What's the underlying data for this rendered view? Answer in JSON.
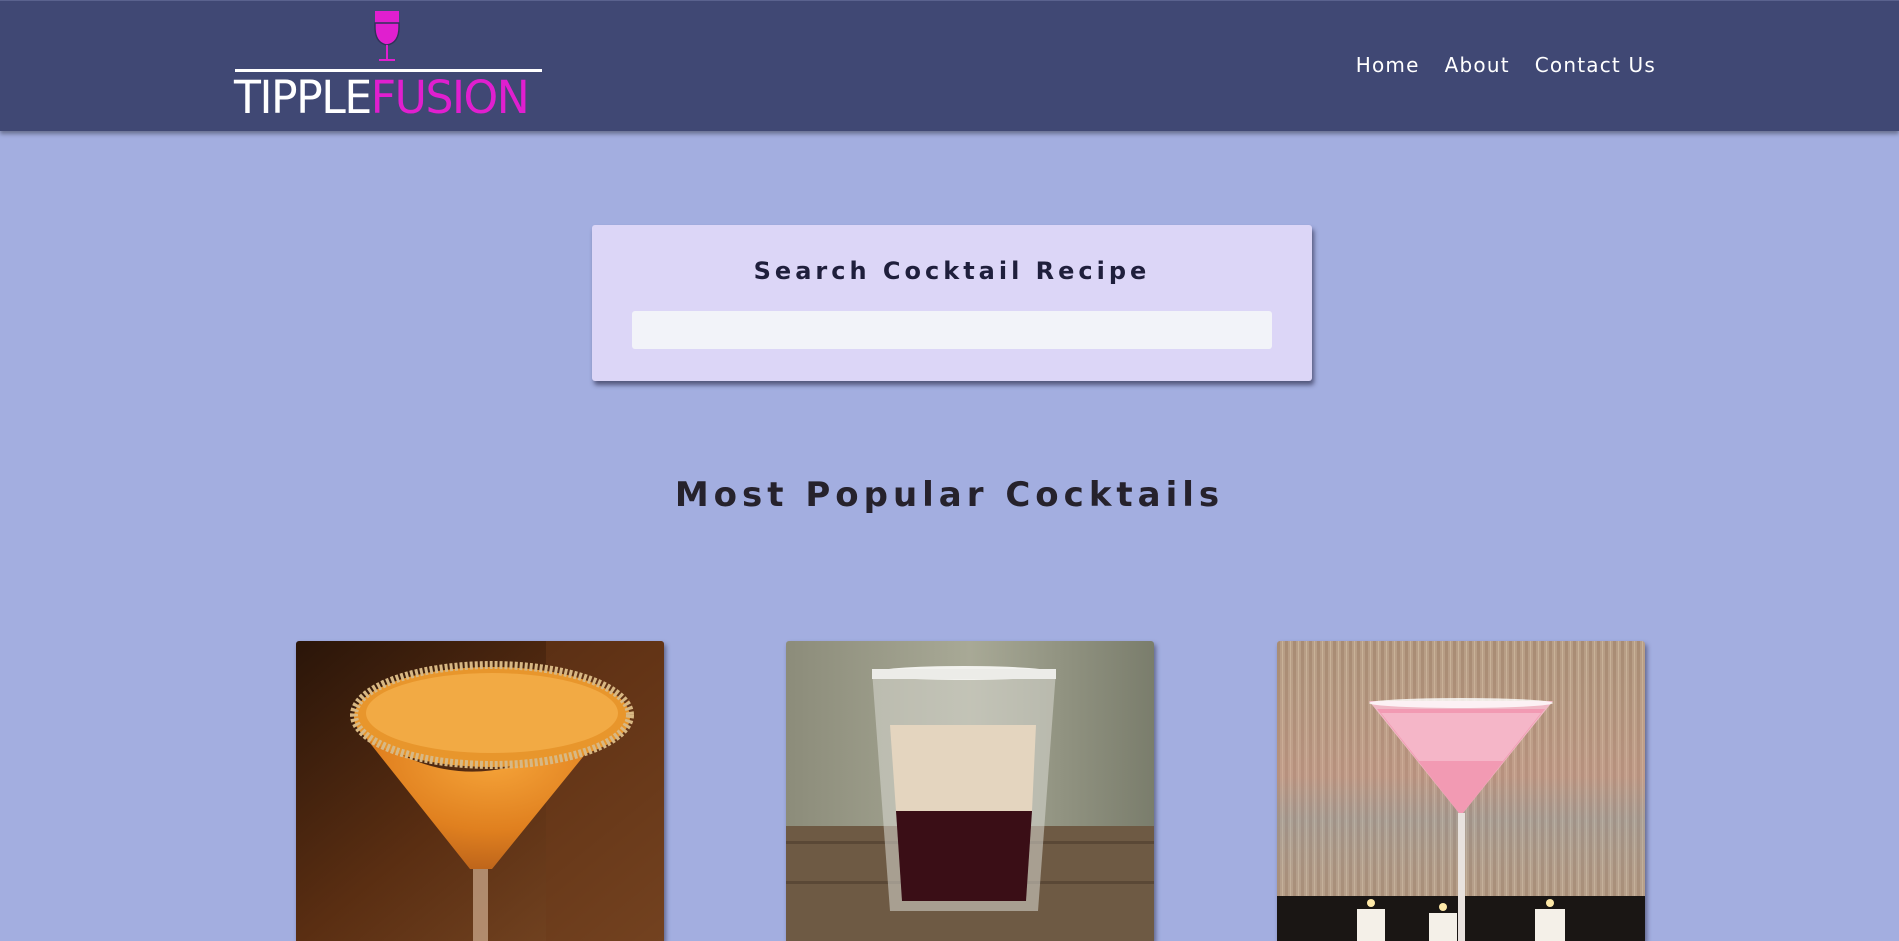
{
  "header": {
    "logo": {
      "brand_part_1": "TIPPLE",
      "brand_part_2": "FUSION",
      "colors": {
        "white": "#ffffff",
        "accent": "#e01fcf"
      },
      "icon": "wine-glass-icon"
    },
    "nav": [
      {
        "label": "Home"
      },
      {
        "label": "About"
      },
      {
        "label": "Contact Us"
      }
    ]
  },
  "search": {
    "title": "Search Cocktail Recipe",
    "value": "",
    "placeholder": ""
  },
  "popular": {
    "title": "Most Popular Cocktails",
    "cards": [
      {
        "image": "orange-martini-sugar-rim-photo"
      },
      {
        "image": "layered-shot-glass-photo"
      },
      {
        "image": "pink-martini-candles-photo"
      }
    ]
  },
  "colors": {
    "page_background": "#a3aee0",
    "navbar": "#404874",
    "search_card": "#dcd6f7",
    "heading_text": "#26222c"
  }
}
